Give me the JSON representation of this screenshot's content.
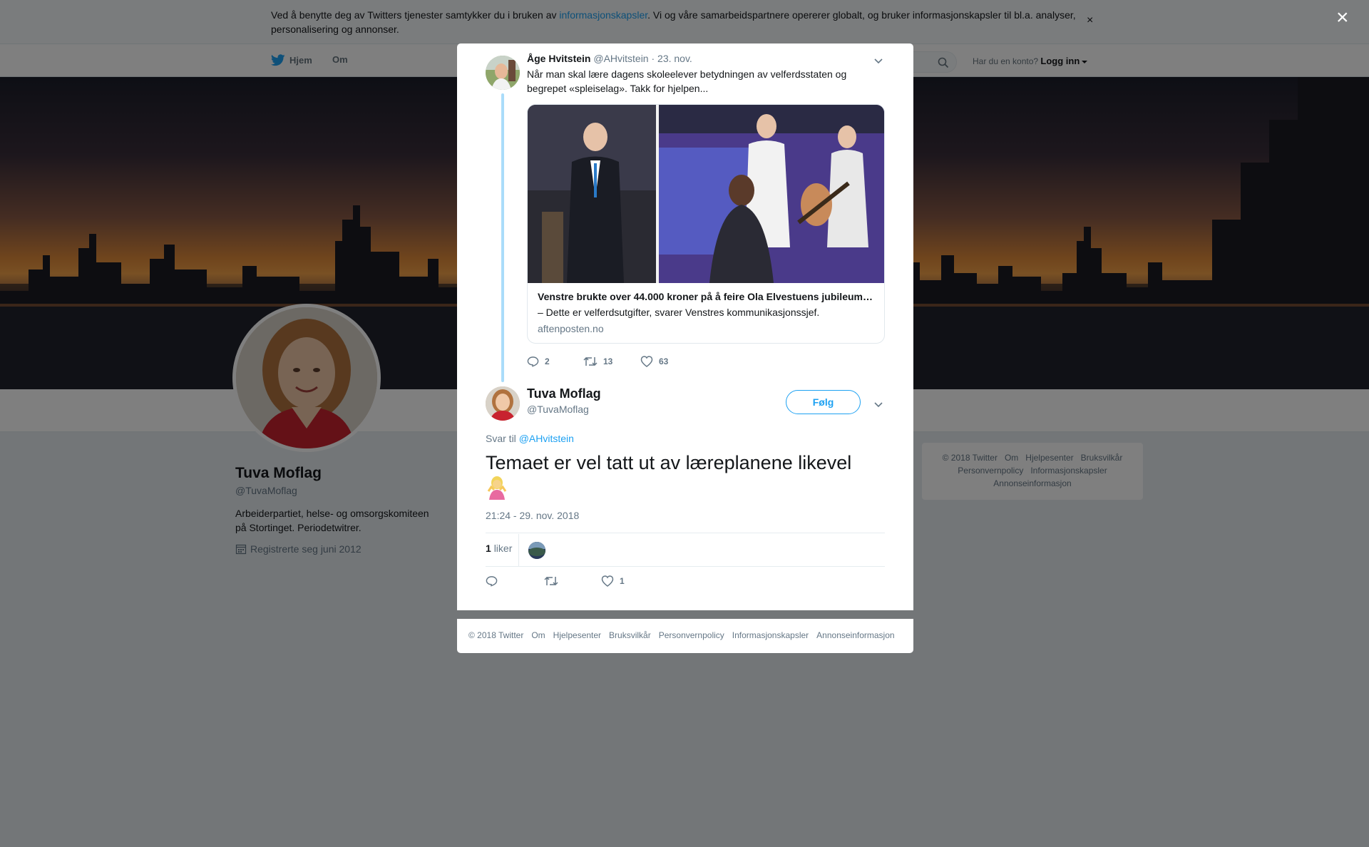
{
  "cookie_bar": {
    "text_before": "Ved å benytte deg av Twitters tjenester samtykker du i bruken av ",
    "link": "informasjonskapsler",
    "text_after": ". Vi og våre samarbeidspartnere opererer globalt, og bruker informasjonskapsler til bl.a. analyser, personalisering og annonser.",
    "close": "×"
  },
  "nav": {
    "home": "Hjem",
    "about": "Om",
    "login_prompt": "Har du en konto?",
    "login": "Logg inn"
  },
  "profile": {
    "name": "Tuva Moflag",
    "handle": "@TuvaMoflag",
    "bio": "Arbeiderpartiet, helse- og omsorgskomiteen på Stortinget. Periodetwitrer.",
    "joined": "Registrerte seg juni 2012"
  },
  "side_footer": {
    "links": [
      "© 2018 Twitter",
      "Om",
      "Hjelpesenter",
      "Bruksvilkår",
      "Personvernpolicy",
      "Informasjonskapsler",
      "Annonseinformasjon"
    ]
  },
  "overlay": {
    "close": "×"
  },
  "parent_tweet": {
    "name": "Åge Hvitstein",
    "handle": "@AHvitstein",
    "separator": "·",
    "date": "23. nov.",
    "text": "Når man skal lære dagens skoleelever betydningen av velferdsstaten og begrepet «spleiselag». Takk for hjelpen...",
    "card": {
      "title": "Venstre brukte over 44.000 kroner på å feire Ola Elvestuens jubileum…",
      "description": "– Dette er velferdsutgifter, svarer Venstres kommunikasjonssjef.",
      "domain": "aftenposten.no"
    },
    "replies": "2",
    "retweets": "13",
    "likes": "63"
  },
  "main_tweet": {
    "name": "Tuva Moflag",
    "handle": "@TuvaMoflag",
    "follow": "Følg",
    "reply_to_label": "Svar til",
    "reply_to_handle": "@AHvitstein",
    "text": "Temaet er vel tatt ut av læreplanene likevel",
    "timestamp": "21:24 - 29. nov. 2018",
    "likes_count": "1",
    "likes_label": "liker",
    "action_likes": "1"
  },
  "modal_footer": {
    "links": [
      "© 2018 Twitter",
      "Om",
      "Hjelpesenter",
      "Bruksvilkår",
      "Personvernpolicy",
      "Informasjonskapsler",
      "Annonseinformasjon"
    ]
  },
  "icons": {
    "twitter_bird": "twitter-bird-icon",
    "search": "search-icon",
    "calendar": "calendar-icon",
    "reply": "reply-icon",
    "retweet": "retweet-icon",
    "like": "heart-icon",
    "chevron": "chevron-down-icon",
    "emoji": "person-shrugging-emoji"
  },
  "colors": {
    "accent": "#1da1f2",
    "thread_line": "#aadcfa",
    "muted_text": "#657786"
  }
}
